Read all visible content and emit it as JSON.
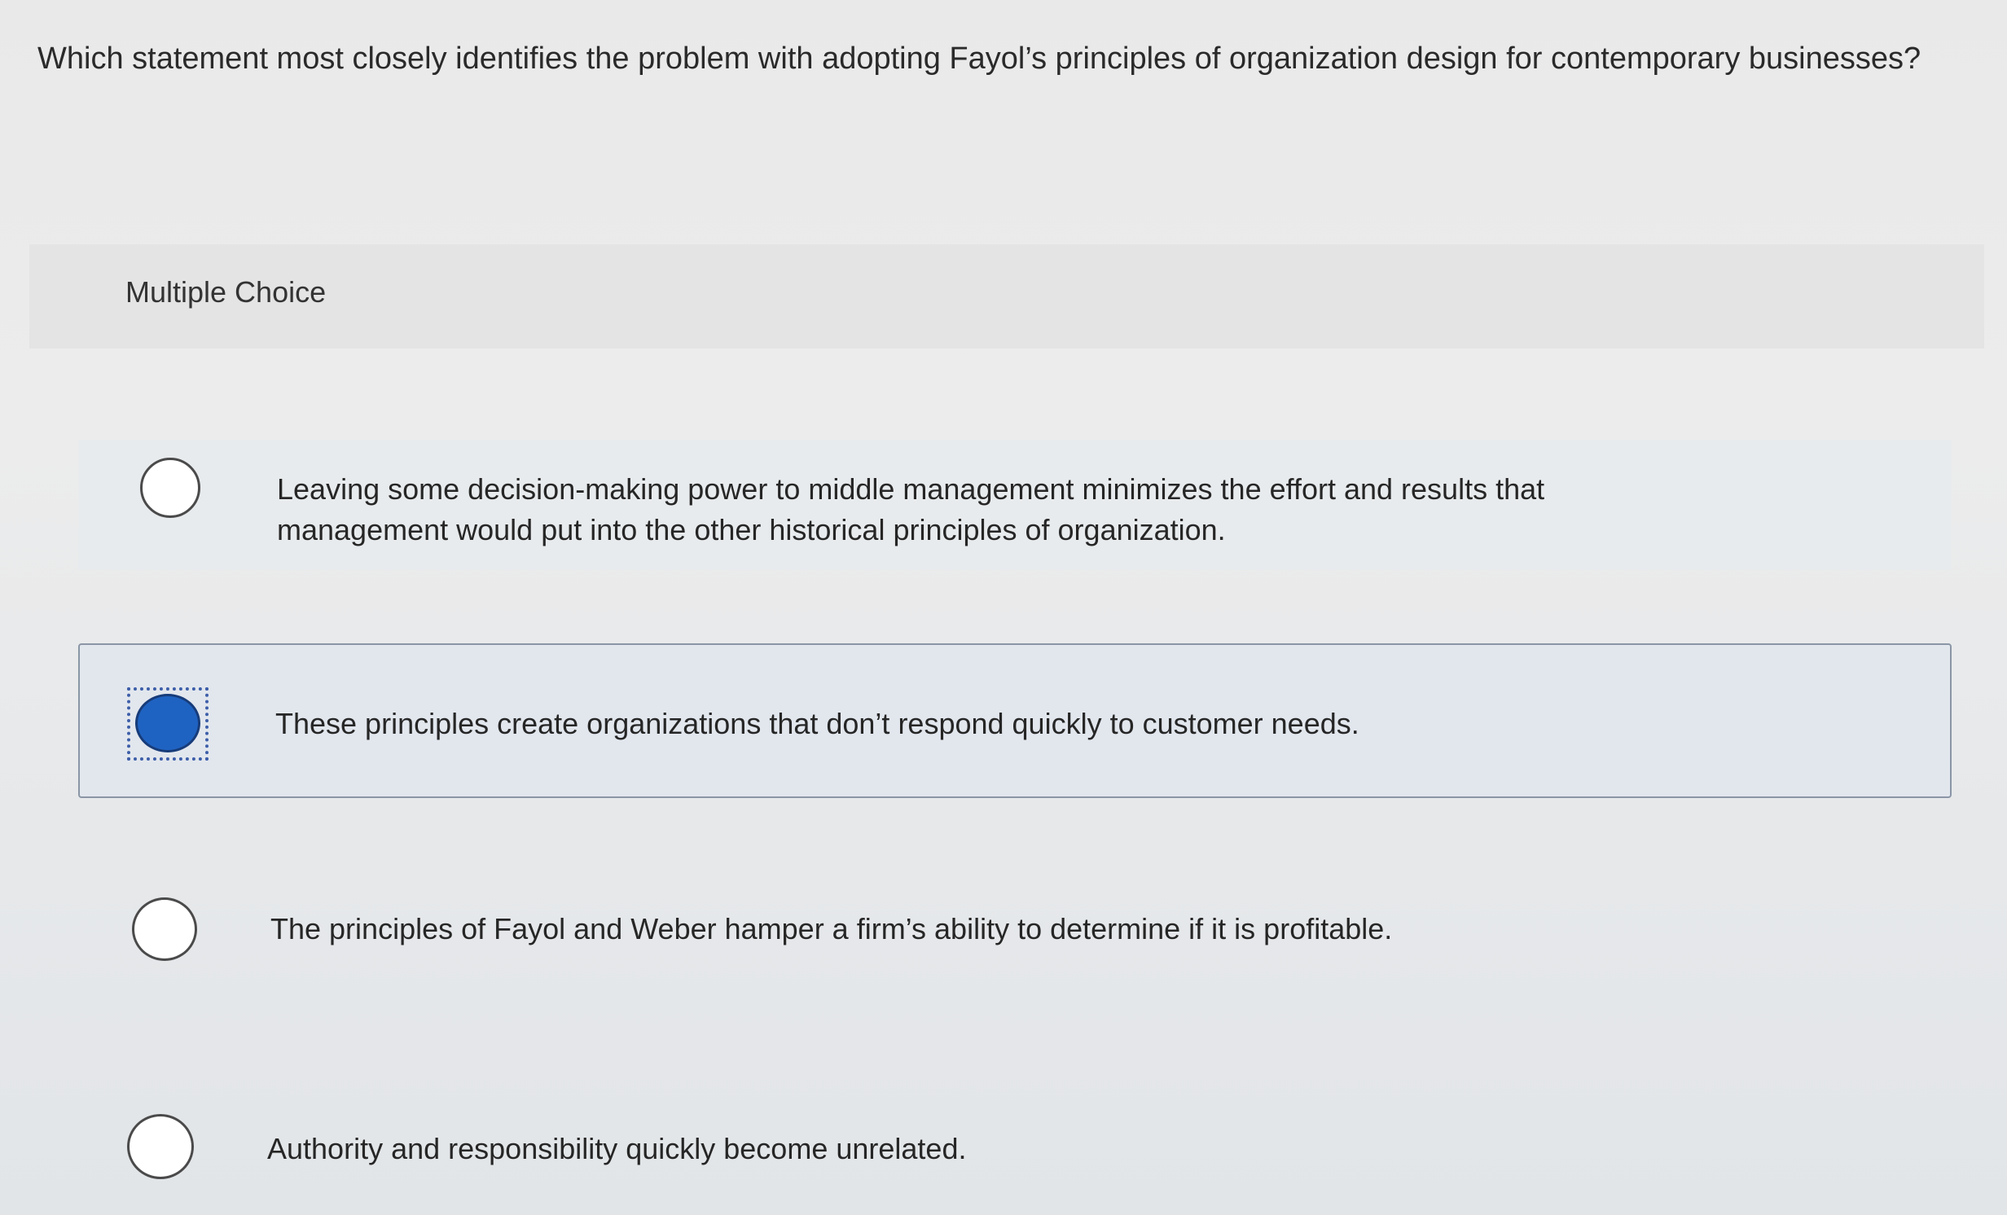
{
  "question": {
    "text": "Which statement most closely identifies the problem with adopting Fayol’s principles of organization design for contemporary businesses?"
  },
  "section": {
    "label": "Multiple Choice"
  },
  "options": [
    {
      "text_line1": "Leaving some decision-making power to middle management minimizes the effort and results that",
      "text_line2": "management would put into the other historical principles of organization.",
      "selected": false
    },
    {
      "text_line1": "These principles create organizations that don’t respond quickly to customer needs.",
      "selected": true
    },
    {
      "text_line1": "The principles of Fayol and Weber hamper a firm’s ability to determine if it is profitable.",
      "selected": false
    },
    {
      "text_line1": "Authority and responsibility quickly become unrelated.",
      "selected": false
    }
  ],
  "colors": {
    "selected_radio": "#1f63c2",
    "selected_row_bg": "#e2e7ee",
    "focus_outline": "#3d5ea8"
  },
  "icons": {
    "radio_empty": "radio-empty-icon",
    "radio_selected": "radio-selected-icon"
  }
}
